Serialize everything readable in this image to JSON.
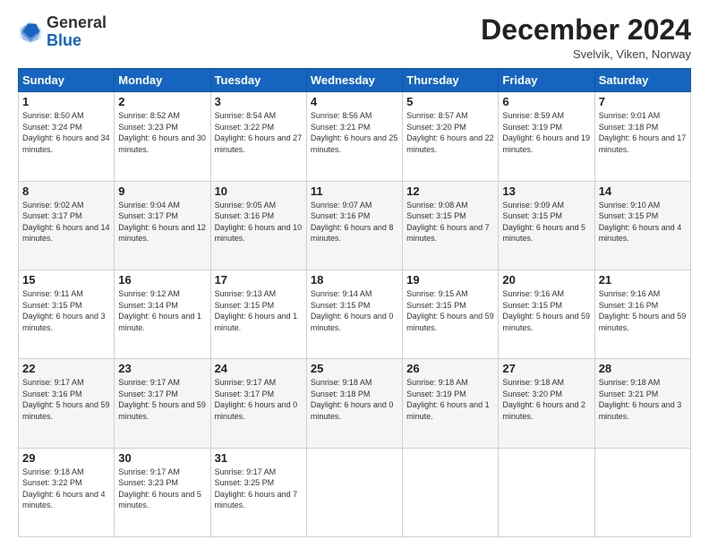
{
  "header": {
    "logo_general": "General",
    "logo_blue": "Blue",
    "month_title": "December 2024",
    "location": "Svelvik, Viken, Norway"
  },
  "days_of_week": [
    "Sunday",
    "Monday",
    "Tuesday",
    "Wednesday",
    "Thursday",
    "Friday",
    "Saturday"
  ],
  "weeks": [
    [
      {
        "day": "1",
        "sunrise": "8:50 AM",
        "sunset": "3:24 PM",
        "daylight": "6 hours and 34 minutes."
      },
      {
        "day": "2",
        "sunrise": "8:52 AM",
        "sunset": "3:23 PM",
        "daylight": "6 hours and 30 minutes."
      },
      {
        "day": "3",
        "sunrise": "8:54 AM",
        "sunset": "3:22 PM",
        "daylight": "6 hours and 27 minutes."
      },
      {
        "day": "4",
        "sunrise": "8:56 AM",
        "sunset": "3:21 PM",
        "daylight": "6 hours and 25 minutes."
      },
      {
        "day": "5",
        "sunrise": "8:57 AM",
        "sunset": "3:20 PM",
        "daylight": "6 hours and 22 minutes."
      },
      {
        "day": "6",
        "sunrise": "8:59 AM",
        "sunset": "3:19 PM",
        "daylight": "6 hours and 19 minutes."
      },
      {
        "day": "7",
        "sunrise": "9:01 AM",
        "sunset": "3:18 PM",
        "daylight": "6 hours and 17 minutes."
      }
    ],
    [
      {
        "day": "8",
        "sunrise": "9:02 AM",
        "sunset": "3:17 PM",
        "daylight": "6 hours and 14 minutes."
      },
      {
        "day": "9",
        "sunrise": "9:04 AM",
        "sunset": "3:17 PM",
        "daylight": "6 hours and 12 minutes."
      },
      {
        "day": "10",
        "sunrise": "9:05 AM",
        "sunset": "3:16 PM",
        "daylight": "6 hours and 10 minutes."
      },
      {
        "day": "11",
        "sunrise": "9:07 AM",
        "sunset": "3:16 PM",
        "daylight": "6 hours and 8 minutes."
      },
      {
        "day": "12",
        "sunrise": "9:08 AM",
        "sunset": "3:15 PM",
        "daylight": "6 hours and 7 minutes."
      },
      {
        "day": "13",
        "sunrise": "9:09 AM",
        "sunset": "3:15 PM",
        "daylight": "6 hours and 5 minutes."
      },
      {
        "day": "14",
        "sunrise": "9:10 AM",
        "sunset": "3:15 PM",
        "daylight": "6 hours and 4 minutes."
      }
    ],
    [
      {
        "day": "15",
        "sunrise": "9:11 AM",
        "sunset": "3:15 PM",
        "daylight": "6 hours and 3 minutes."
      },
      {
        "day": "16",
        "sunrise": "9:12 AM",
        "sunset": "3:14 PM",
        "daylight": "6 hours and 1 minute."
      },
      {
        "day": "17",
        "sunrise": "9:13 AM",
        "sunset": "3:15 PM",
        "daylight": "6 hours and 1 minute."
      },
      {
        "day": "18",
        "sunrise": "9:14 AM",
        "sunset": "3:15 PM",
        "daylight": "6 hours and 0 minutes."
      },
      {
        "day": "19",
        "sunrise": "9:15 AM",
        "sunset": "3:15 PM",
        "daylight": "5 hours and 59 minutes."
      },
      {
        "day": "20",
        "sunrise": "9:16 AM",
        "sunset": "3:15 PM",
        "daylight": "5 hours and 59 minutes."
      },
      {
        "day": "21",
        "sunrise": "9:16 AM",
        "sunset": "3:16 PM",
        "daylight": "5 hours and 59 minutes."
      }
    ],
    [
      {
        "day": "22",
        "sunrise": "9:17 AM",
        "sunset": "3:16 PM",
        "daylight": "5 hours and 59 minutes."
      },
      {
        "day": "23",
        "sunrise": "9:17 AM",
        "sunset": "3:17 PM",
        "daylight": "5 hours and 59 minutes."
      },
      {
        "day": "24",
        "sunrise": "9:17 AM",
        "sunset": "3:17 PM",
        "daylight": "6 hours and 0 minutes."
      },
      {
        "day": "25",
        "sunrise": "9:18 AM",
        "sunset": "3:18 PM",
        "daylight": "6 hours and 0 minutes."
      },
      {
        "day": "26",
        "sunrise": "9:18 AM",
        "sunset": "3:19 PM",
        "daylight": "6 hours and 1 minute."
      },
      {
        "day": "27",
        "sunrise": "9:18 AM",
        "sunset": "3:20 PM",
        "daylight": "6 hours and 2 minutes."
      },
      {
        "day": "28",
        "sunrise": "9:18 AM",
        "sunset": "3:21 PM",
        "daylight": "6 hours and 3 minutes."
      }
    ],
    [
      {
        "day": "29",
        "sunrise": "9:18 AM",
        "sunset": "3:22 PM",
        "daylight": "6 hours and 4 minutes."
      },
      {
        "day": "30",
        "sunrise": "9:17 AM",
        "sunset": "3:23 PM",
        "daylight": "6 hours and 5 minutes."
      },
      {
        "day": "31",
        "sunrise": "9:17 AM",
        "sunset": "3:25 PM",
        "daylight": "6 hours and 7 minutes."
      },
      null,
      null,
      null,
      null
    ]
  ]
}
